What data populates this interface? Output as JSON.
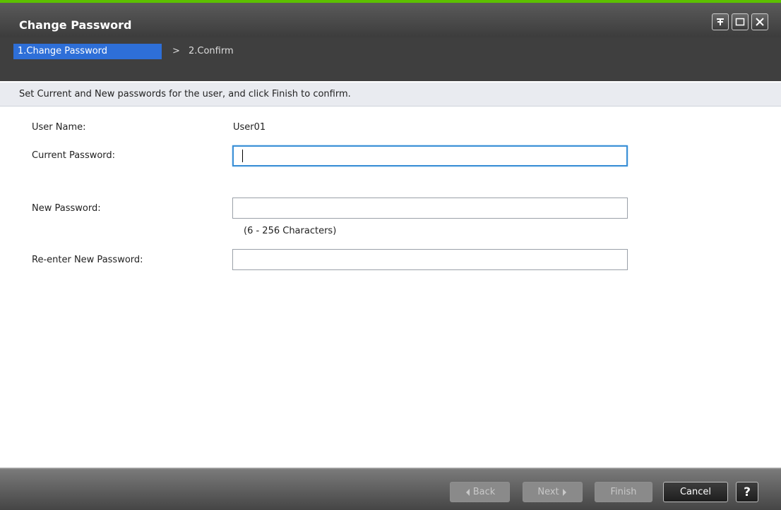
{
  "window": {
    "title": "Change Password",
    "accent_color": "#5cc000",
    "controls": [
      "pin-icon",
      "maximize-icon",
      "close-icon"
    ]
  },
  "steps": {
    "current": "1.Change Password",
    "separator": ">",
    "next": "2.Confirm",
    "active_color": "#2e6fd8"
  },
  "instruction": "Set Current and New passwords for the user, and click Finish to confirm.",
  "form": {
    "user_name_label": "User Name:",
    "user_name_value": "User01",
    "current_password_label": "Current Password:",
    "current_password_value": "",
    "new_password_label": "New Password:",
    "new_password_value": "",
    "new_password_hint": "(6 - 256 Characters)",
    "reenter_password_label": "Re-enter New Password:",
    "reenter_password_value": ""
  },
  "buttons": {
    "back": "Back",
    "next": "Next",
    "finish": "Finish",
    "cancel": "Cancel",
    "help": "?"
  }
}
